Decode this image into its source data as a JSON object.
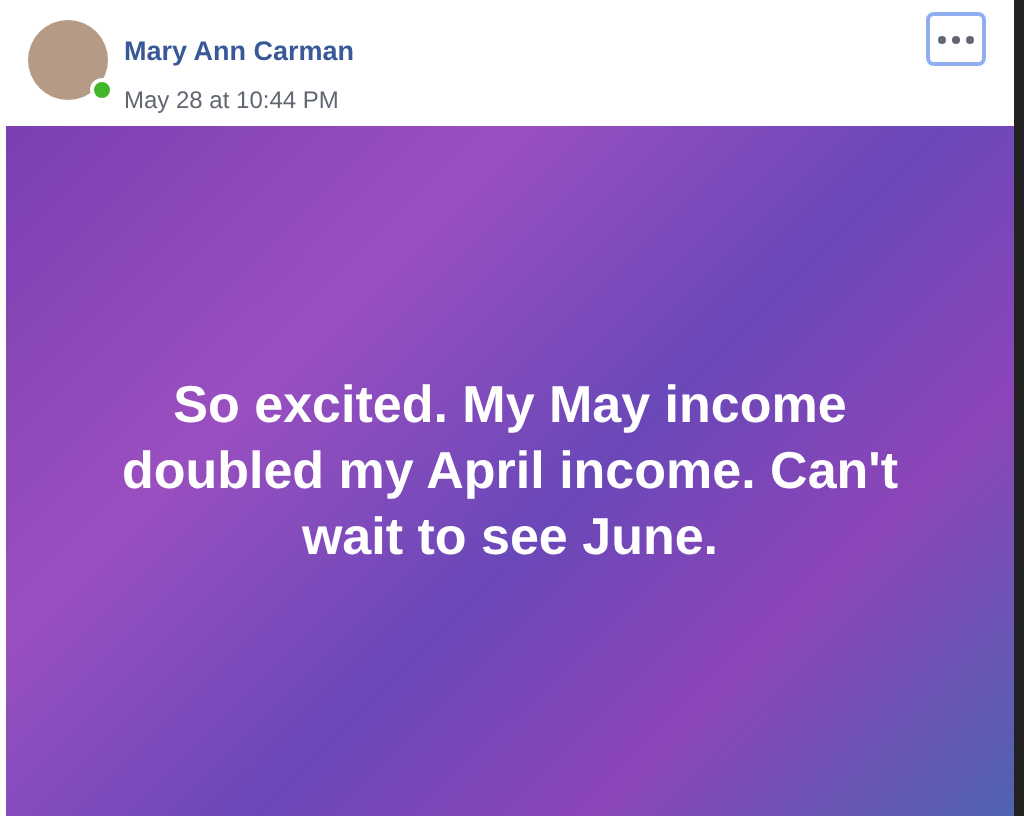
{
  "post": {
    "author": "Mary Ann Carman",
    "online": true,
    "timestamp": "May 28 at 10:44 PM",
    "menu_focused": true,
    "text": "So excited. My May income doubled my April income. Can't wait to see June."
  }
}
